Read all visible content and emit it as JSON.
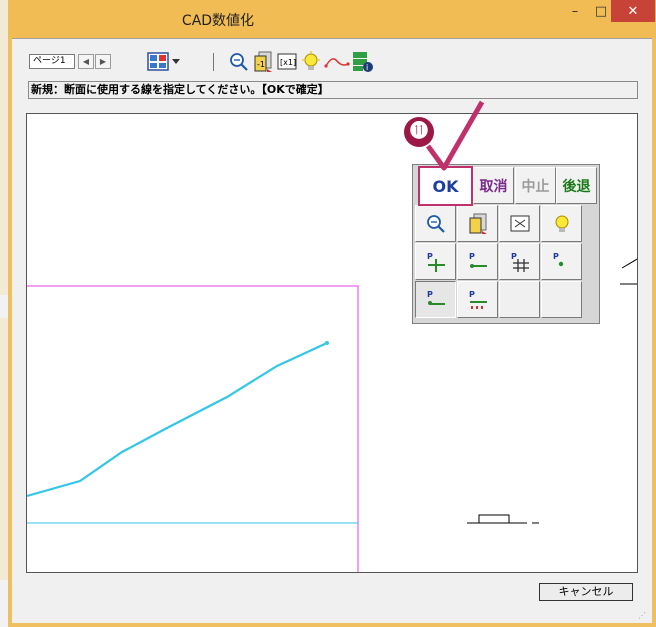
{
  "window": {
    "title": "CAD数値化",
    "controls": {
      "minimize": "–",
      "maximize": "□",
      "close": "✕"
    }
  },
  "toolbar": {
    "page_label": "ページ1",
    "prev_arrow": "◀",
    "next_arrow": "▶",
    "icons": [
      "layout-icon",
      "dropdown-icon",
      "zoom-icon",
      "page-icon",
      "fit-icon",
      "light-bulb-icon",
      "curve-icon",
      "info-icon"
    ]
  },
  "prompt": {
    "text": "新規：断面に使用する線を指定してください。【OKで確定】"
  },
  "palette": {
    "row1": {
      "ok": "OK",
      "cancel": "取消",
      "stop": "中止",
      "back": "後退"
    },
    "colors": {
      "ok": "#1f3fa0",
      "cancel": "#7a2a8a",
      "stop": "#9a9a9a",
      "back": "#1a7a1a"
    }
  },
  "annotation": {
    "badge": "⓫"
  },
  "footer": {
    "cancel_label": "キャンセル"
  },
  "colors": {
    "titlebar": "#f2bc55",
    "close_button": "#c74338",
    "frame_magenta": "#e040e0",
    "trace_line": "#33c6e6",
    "highlight": "#c0306a"
  }
}
